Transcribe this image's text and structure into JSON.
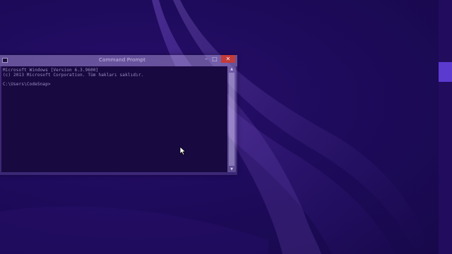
{
  "window": {
    "title": "Command Prompt",
    "minimize_glyph": "–",
    "maximize_glyph": "□",
    "close_glyph": "✕"
  },
  "console": {
    "lines": [
      "Microsoft Windows [Version 6.3.9600]",
      "(c) 2013 Microsoft Corporation. Tüm hakları saklıdır.",
      "",
      "C:\\Users\\CodeSnap>"
    ]
  },
  "icons": {
    "app": "console-app-icon",
    "cursor": "mouse-pointer-icon",
    "scroll_up": "▲",
    "scroll_down": "▼"
  },
  "colors": {
    "desktop_background": "#1d0a55",
    "console_background": "#190941",
    "console_text": "#9e93c4",
    "close_button": "#c43a3a",
    "accent": "#5b3ad0"
  }
}
